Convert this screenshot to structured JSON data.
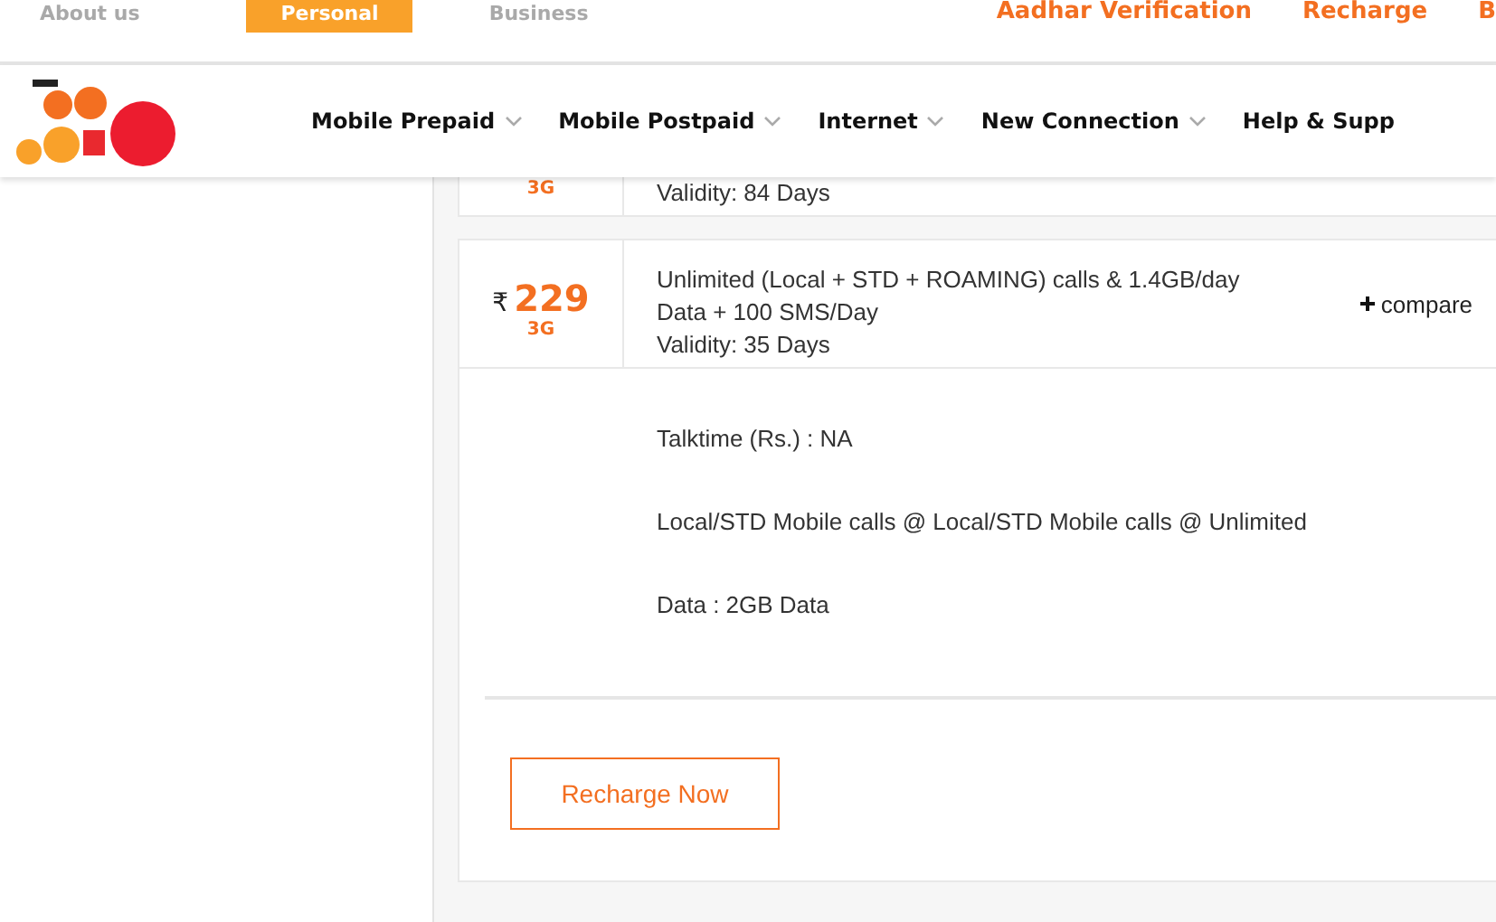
{
  "top_tabs": [
    {
      "label": "About us",
      "selected": false
    },
    {
      "label": "Personal",
      "selected": true
    },
    {
      "label": "Business",
      "selected": false
    }
  ],
  "top_links": [
    "Aadhar Verification",
    "Recharge",
    "B"
  ],
  "nav": [
    {
      "label": "Mobile Prepaid",
      "dropdown": true
    },
    {
      "label": "Mobile Postpaid",
      "dropdown": true
    },
    {
      "label": "Internet",
      "dropdown": true
    },
    {
      "label": "New Connection",
      "dropdown": true
    },
    {
      "label": "Help & Supp",
      "dropdown": false
    }
  ],
  "plans": [
    {
      "network": "3G",
      "lines": [
        "Validity: 84 Days"
      ],
      "expanded": false
    },
    {
      "currency": "₹",
      "price": "229",
      "network": "3G",
      "lines": [
        "Unlimited (Local + STD + ROAMING) calls & 1.4GB/day",
        "Data + 100 SMS/Day",
        "Validity: 35 Days"
      ],
      "compare": "compare",
      "expanded": true,
      "details": [
        "Talktime (Rs.) : NA",
        "Local/STD Mobile calls @ Local/STD Mobile calls @ Unlimited",
        "Data : 2GB Data"
      ],
      "action": "Recharge Now"
    }
  ]
}
